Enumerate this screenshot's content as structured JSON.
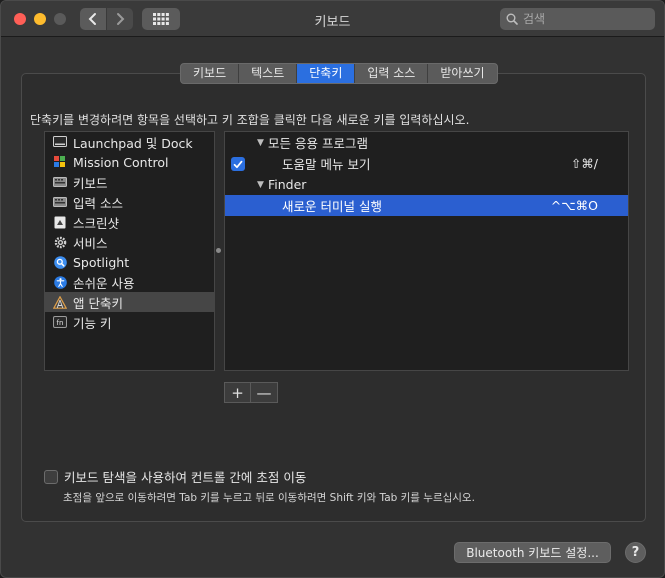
{
  "window": {
    "title": "키보드"
  },
  "search": {
    "placeholder": "검색"
  },
  "tabs": [
    {
      "label": "키보드",
      "active": false
    },
    {
      "label": "텍스트",
      "active": false
    },
    {
      "label": "단축키",
      "active": true
    },
    {
      "label": "입력 소스",
      "active": false
    },
    {
      "label": "받아쓰기",
      "active": false
    }
  ],
  "instruction": "단축키를 변경하려면 항목을 선택하고 키 조합을 클릭한 다음 새로운 키를 입력하십시오.",
  "categories": [
    {
      "label": "Launchpad 및 Dock",
      "icon": "launchpad-icon"
    },
    {
      "label": "Mission Control",
      "icon": "mission-control-icon"
    },
    {
      "label": "키보드",
      "icon": "keyboard-icon"
    },
    {
      "label": "입력 소스",
      "icon": "input-source-icon"
    },
    {
      "label": "스크린샷",
      "icon": "screenshot-icon"
    },
    {
      "label": "서비스",
      "icon": "gear-icon"
    },
    {
      "label": "Spotlight",
      "icon": "spotlight-icon"
    },
    {
      "label": "손쉬운 사용",
      "icon": "accessibility-icon"
    },
    {
      "label": "앱 단축키",
      "icon": "app-shortcuts-icon",
      "selected": true
    },
    {
      "label": "기능 키",
      "icon": "fn-key-icon"
    }
  ],
  "shortcuts": {
    "group1": {
      "label": "모든 응용 프로그램"
    },
    "item1": {
      "label": "도움말 메뉴 보기",
      "keys": "⇧⌘/",
      "checked": true
    },
    "group2": {
      "label": "Finder"
    },
    "item2": {
      "label": "새로운 터미널 실행",
      "keys": "^⌥⌘O",
      "selected": true
    }
  },
  "buttons": {
    "add": "+",
    "remove": "—",
    "bluetooth": "Bluetooth 키보드 설정...",
    "help": "?"
  },
  "keyboard_nav": {
    "label": "키보드 탐색을 사용하여 컨트롤 간에 초점 이동",
    "hint": "초점을 앞으로 이동하려면 Tab 키를 누르고 뒤로 이동하려면 Shift 키와 Tab 키를 누르십시오.",
    "checked": false
  },
  "colors": {
    "accent": "#2b6fe0",
    "selection": "#2b5fd0",
    "background": "#323232"
  }
}
